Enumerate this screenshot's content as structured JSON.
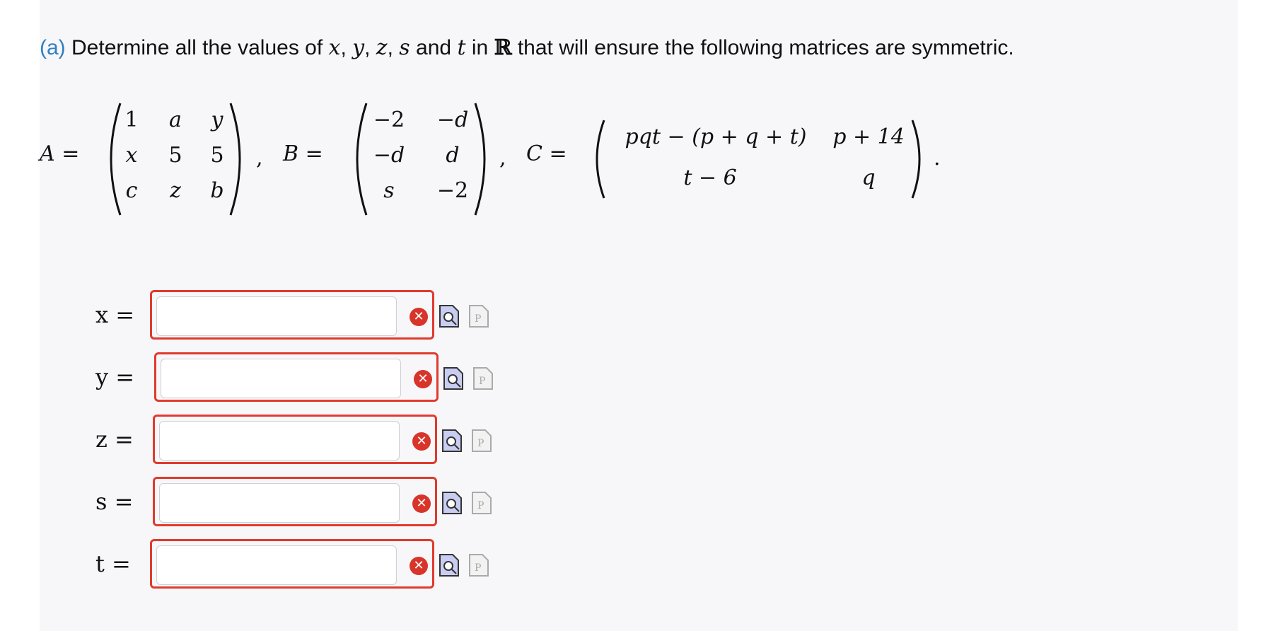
{
  "question": {
    "part_label": "(a)",
    "text_1": "Determine all the values of",
    "var_x": "x",
    "sep_1": ",",
    "var_y": "y",
    "sep_2": ",",
    "var_z": "z",
    "sep_3": ",",
    "var_s": "s",
    "and_1": "and",
    "var_t": "t",
    "in_text": "in",
    "set_R": "ℝ",
    "text_2": "that will ensure the following matrices are symmetric."
  },
  "matrices": {
    "A": {
      "label": "A =",
      "rows": [
        [
          "1",
          "a",
          "y"
        ],
        [
          "x",
          "5",
          "5"
        ],
        [
          "c",
          "z",
          "b"
        ]
      ]
    },
    "B": {
      "label": "B =",
      "rows": [
        [
          "−2",
          "−d"
        ],
        [
          "−d",
          "d"
        ],
        [
          "s",
          "−2"
        ]
      ]
    },
    "C": {
      "label": "C =",
      "rows": [
        [
          "pqt − (p + q + t)",
          "p + 14"
        ],
        [
          "t − 6",
          "q"
        ]
      ]
    },
    "comma": ",",
    "period": "."
  },
  "answers": [
    {
      "label": "x =",
      "value": "",
      "placeholder": ""
    },
    {
      "label": "y =",
      "value": "",
      "placeholder": ""
    },
    {
      "label": "z =",
      "value": "",
      "placeholder": ""
    },
    {
      "label": "s =",
      "value": "",
      "placeholder": ""
    },
    {
      "label": "t =",
      "value": "",
      "placeholder": ""
    }
  ],
  "icons": {
    "error": "error-x-icon",
    "preview": "preview-magnifier-icon",
    "p_document": "p-document-icon"
  },
  "colors": {
    "accent": "#2f7fc1",
    "error_border": "#e03a2c",
    "error_icon": "#d8342a",
    "panel_bg": "#f7f7fa"
  }
}
